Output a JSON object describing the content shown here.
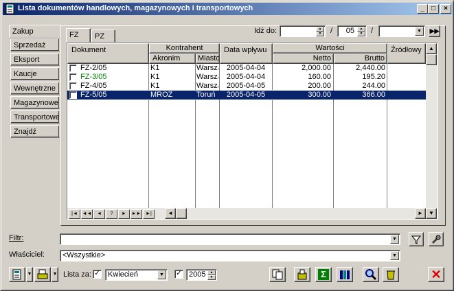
{
  "window": {
    "title": "Lista dokumentów handlowych, magazynowych i transportowych",
    "min": "_",
    "max": "□",
    "close": "×"
  },
  "left_tabs": [
    "Zakup",
    "Sprzedaż",
    "Eksport",
    "Kaucje",
    "Wewnętrzne",
    "Magazynowe",
    "Transportowe",
    "Znajdź"
  ],
  "top_tabs": [
    "FZ",
    "PZ"
  ],
  "goto": {
    "label": "Idź do:",
    "day": "",
    "month": "05",
    "year": "",
    "sep": "/"
  },
  "table": {
    "headers": {
      "dokument": "Dokument",
      "kontrahent": "Kontrahent",
      "akronim": "Akronim",
      "miasto": "Miasto",
      "data": "Data wpływu",
      "wartosci": "Wartości",
      "netto": "Netto",
      "brutto": "Brutto",
      "zrodlowy": "Źródłowy"
    },
    "rows": [
      {
        "doc": "FZ-2/05",
        "akronim": "K1",
        "miasto": "Warszawa",
        "data": "2005-04-04",
        "netto": "2,000.00",
        "brutto": "2,440.00",
        "color": "#000000",
        "selected": false
      },
      {
        "doc": "FZ-3/05",
        "akronim": "K1",
        "miasto": "Warszawa",
        "data": "2005-04-04",
        "netto": "160.00",
        "brutto": "195.20",
        "color": "#008000",
        "selected": false
      },
      {
        "doc": "FZ-4/05",
        "akronim": "K1",
        "miasto": "Warszawa",
        "data": "2005-04-05",
        "netto": "200.00",
        "brutto": "244.00",
        "color": "#000000",
        "selected": false
      },
      {
        "doc": "FZ-5/05",
        "akronim": "MROZ",
        "miasto": "Toruń",
        "data": "2005-04-05",
        "netto": "300.00",
        "brutto": "366.00",
        "color": "#ffffff",
        "selected": true
      }
    ]
  },
  "nav_buttons": [
    "|◄",
    "◄◄",
    "◄",
    "?",
    "►",
    "►►",
    "►|"
  ],
  "filter": {
    "label": "Filtr:",
    "value": ""
  },
  "owner": {
    "label": "Właściciel:",
    "value": "<Wszystkie>"
  },
  "bottom": {
    "lista_za": "Lista za:",
    "month": "Kwiecień",
    "year": "2005"
  },
  "icons": [
    "new-document-icon",
    "dropdown-icon",
    "print-icon",
    "copy-icon",
    "open-icon",
    "sum-icon",
    "books-icon",
    "search-icon",
    "recycle-icon",
    "close-icon",
    "filter-icon",
    "wrench-icon"
  ]
}
